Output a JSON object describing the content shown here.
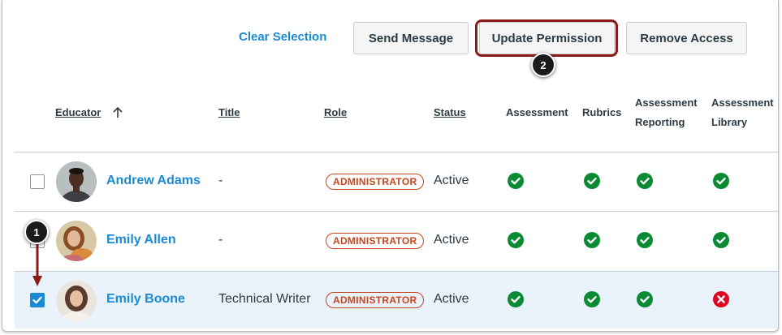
{
  "toolbar": {
    "clear_selection": "Clear Selection",
    "send_message": "Send Message",
    "update_permission": "Update Permission",
    "remove_access": "Remove Access"
  },
  "callouts": {
    "one": "1",
    "two": "2"
  },
  "columns": {
    "educator": "Educator",
    "title": "Title",
    "role": "Role",
    "status": "Status",
    "assessment": "Assessment",
    "rubrics": "Rubrics",
    "assessment_reporting_line1": "Assessment",
    "assessment_reporting_line2": "Reporting",
    "assessment_library_line1": "Assessment",
    "assessment_library_line2": "Library"
  },
  "rows": [
    {
      "name": "Andrew Adams",
      "title": "-",
      "role": "ADMINISTRATOR",
      "status": "Active",
      "checked": false,
      "permissions": {
        "assessment": true,
        "rubrics": true,
        "reporting": true,
        "library": true
      }
    },
    {
      "name": "Emily Allen",
      "title": "-",
      "role": "ADMINISTRATOR",
      "status": "Active",
      "checked": false,
      "permissions": {
        "assessment": true,
        "rubrics": true,
        "reporting": true,
        "library": true
      }
    },
    {
      "name": "Emily Boone",
      "title": "Technical Writer",
      "role": "ADMINISTRATOR",
      "status": "Active",
      "checked": true,
      "permissions": {
        "assessment": true,
        "rubrics": true,
        "reporting": true,
        "library": false
      }
    }
  ],
  "colors": {
    "link": "#1a8bd3",
    "success": "#0b8a34",
    "error": "#e0061f",
    "role_badge": "#c4471f",
    "callout_highlight": "#8b1a1a",
    "selected_row": "#eaf3fb"
  },
  "icons": {
    "granted": "check-circle-icon",
    "denied": "x-circle-icon",
    "sort": "arrow-up-icon"
  }
}
